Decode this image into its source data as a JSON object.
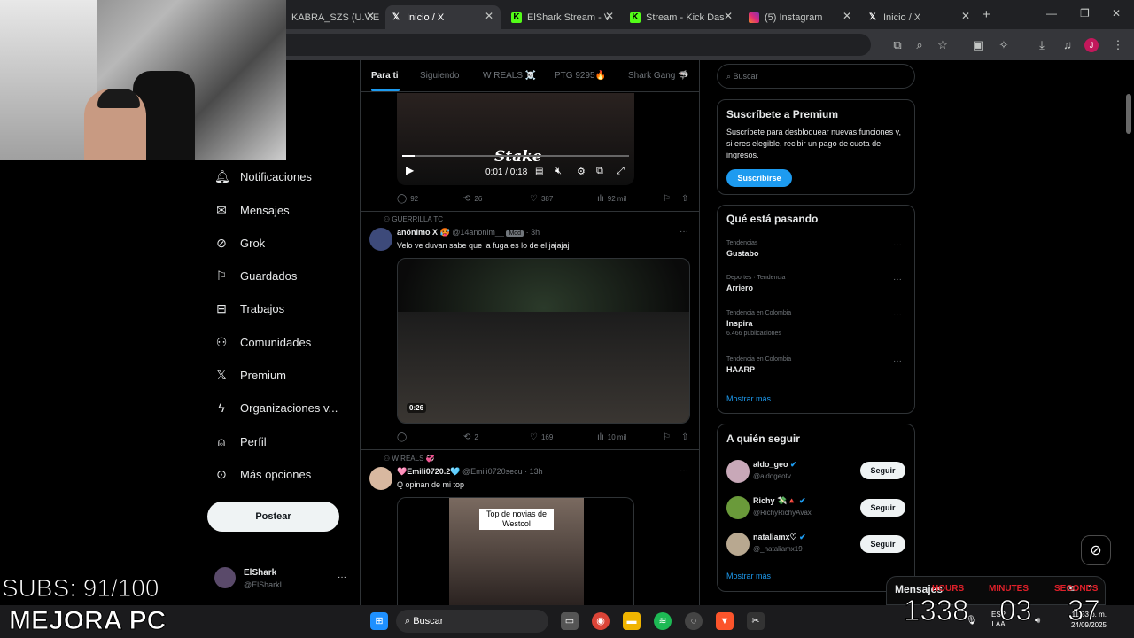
{
  "browser": {
    "tabs": [
      {
        "label": "KABRA_SZS (U.V.E",
        "icon": "tab-favicon"
      },
      {
        "label": "Inicio / X",
        "icon": "x-logo-icon",
        "active": true
      },
      {
        "label": "ElShark Stream - V",
        "icon": "kick-icon"
      },
      {
        "label": "Stream - Kick Das",
        "icon": "kick-icon"
      },
      {
        "label": "(5) Instagram",
        "icon": "instagram-icon"
      },
      {
        "label": "Inicio / X",
        "icon": "x-logo-icon"
      }
    ],
    "new_tab": "+",
    "profile_initial": "J"
  },
  "nav": {
    "items": [
      {
        "label": "Notificaciones",
        "icon": "bell-icon"
      },
      {
        "label": "Mensajes",
        "icon": "mail-icon"
      },
      {
        "label": "Grok",
        "icon": "grok-icon"
      },
      {
        "label": "Guardados",
        "icon": "bookmark-icon"
      },
      {
        "label": "Trabajos",
        "icon": "briefcase-icon"
      },
      {
        "label": "Comunidades",
        "icon": "people-icon"
      },
      {
        "label": "Premium",
        "icon": "x-logo-icon"
      },
      {
        "label": "Organizaciones v...",
        "icon": "lightning-icon"
      },
      {
        "label": "Perfil",
        "icon": "person-icon"
      },
      {
        "label": "Más opciones",
        "icon": "more-circle-icon"
      }
    ],
    "post_button": "Postear",
    "account": {
      "name": "ElShark",
      "handle": "@ElSharkL",
      "more": "···"
    }
  },
  "feed": {
    "tabs": [
      "Para ti",
      "Siguiendo",
      "W REALS ☠️",
      "PTG 9295🔥",
      "Shark Gang 🦈"
    ],
    "video1": {
      "overlay": "Stake",
      "time": "0:01 / 0:18"
    },
    "tweet1_actions": {
      "replies": "92",
      "retweets": "26",
      "likes": "387",
      "views": "92 mil"
    },
    "tweet2": {
      "community": "GUERRILLA TC",
      "name": "anónimo X 🥵",
      "handle": "@14anonim__",
      "badge": "Mod",
      "time": "· 3h",
      "text": "Velo ve duvan sabe que la fuga es lo de el jajajaj",
      "video_duration": "0:26",
      "replies": "",
      "retweets": "2",
      "likes": "169",
      "views": "10 mil"
    },
    "tweet3": {
      "community": "W REALS 💞",
      "name": "🩷Emili0720.2🩵",
      "handle": "@Emili0720secu",
      "time": "· 13h",
      "text": "Q opinan de mi top",
      "image_caption": "Top de novias de Westcol"
    }
  },
  "sidebar": {
    "search_placeholder": "Buscar",
    "premium": {
      "title": "Suscríbete a Premium",
      "text": "Suscríbete para desbloquear nuevas funciones y, si eres elegible, recibir un pago de cuota de ingresos.",
      "button": "Suscribirse"
    },
    "trends": {
      "title": "Qué está pasando",
      "items": [
        {
          "category": "Tendencias",
          "name": "Gustabo",
          "count": ""
        },
        {
          "category": "Deportes · Tendencia",
          "name": "Arriero",
          "count": ""
        },
        {
          "category": "Tendencia en Colombia",
          "name": "Inspira",
          "count": "6.466 publicaciones"
        },
        {
          "category": "Tendencia en Colombia",
          "name": "HAARP",
          "count": ""
        }
      ],
      "show_more": "Mostrar más"
    },
    "follow": {
      "title": "A quién seguir",
      "items": [
        {
          "name": "aldo_geo",
          "handle": "@aldogeotv"
        },
        {
          "name": "Richy 💸🔺",
          "handle": "@RichyRichyAvax"
        },
        {
          "name": "nataliamx♡",
          "handle": "@_nataliamx19"
        }
      ],
      "button": "Seguir",
      "show_more": "Mostrar más"
    },
    "messages_label": "Mensajes"
  },
  "overlay": {
    "subs": "SUBS: 91/100",
    "mejora": "MEJORA PC",
    "timer": {
      "labels": [
        "HOURS",
        "MINUTES",
        "SECONDS"
      ],
      "hours": "1338",
      "minutes": "03",
      "seconds": "37"
    }
  },
  "taskbar": {
    "search": "Buscar",
    "lang": "ESP",
    "lang2": "LAA",
    "time": "11:53 p. m.",
    "date": "24/09/2025"
  },
  "colors": {
    "accent": "#1d9bf0",
    "timer_red": "#e0202a"
  }
}
